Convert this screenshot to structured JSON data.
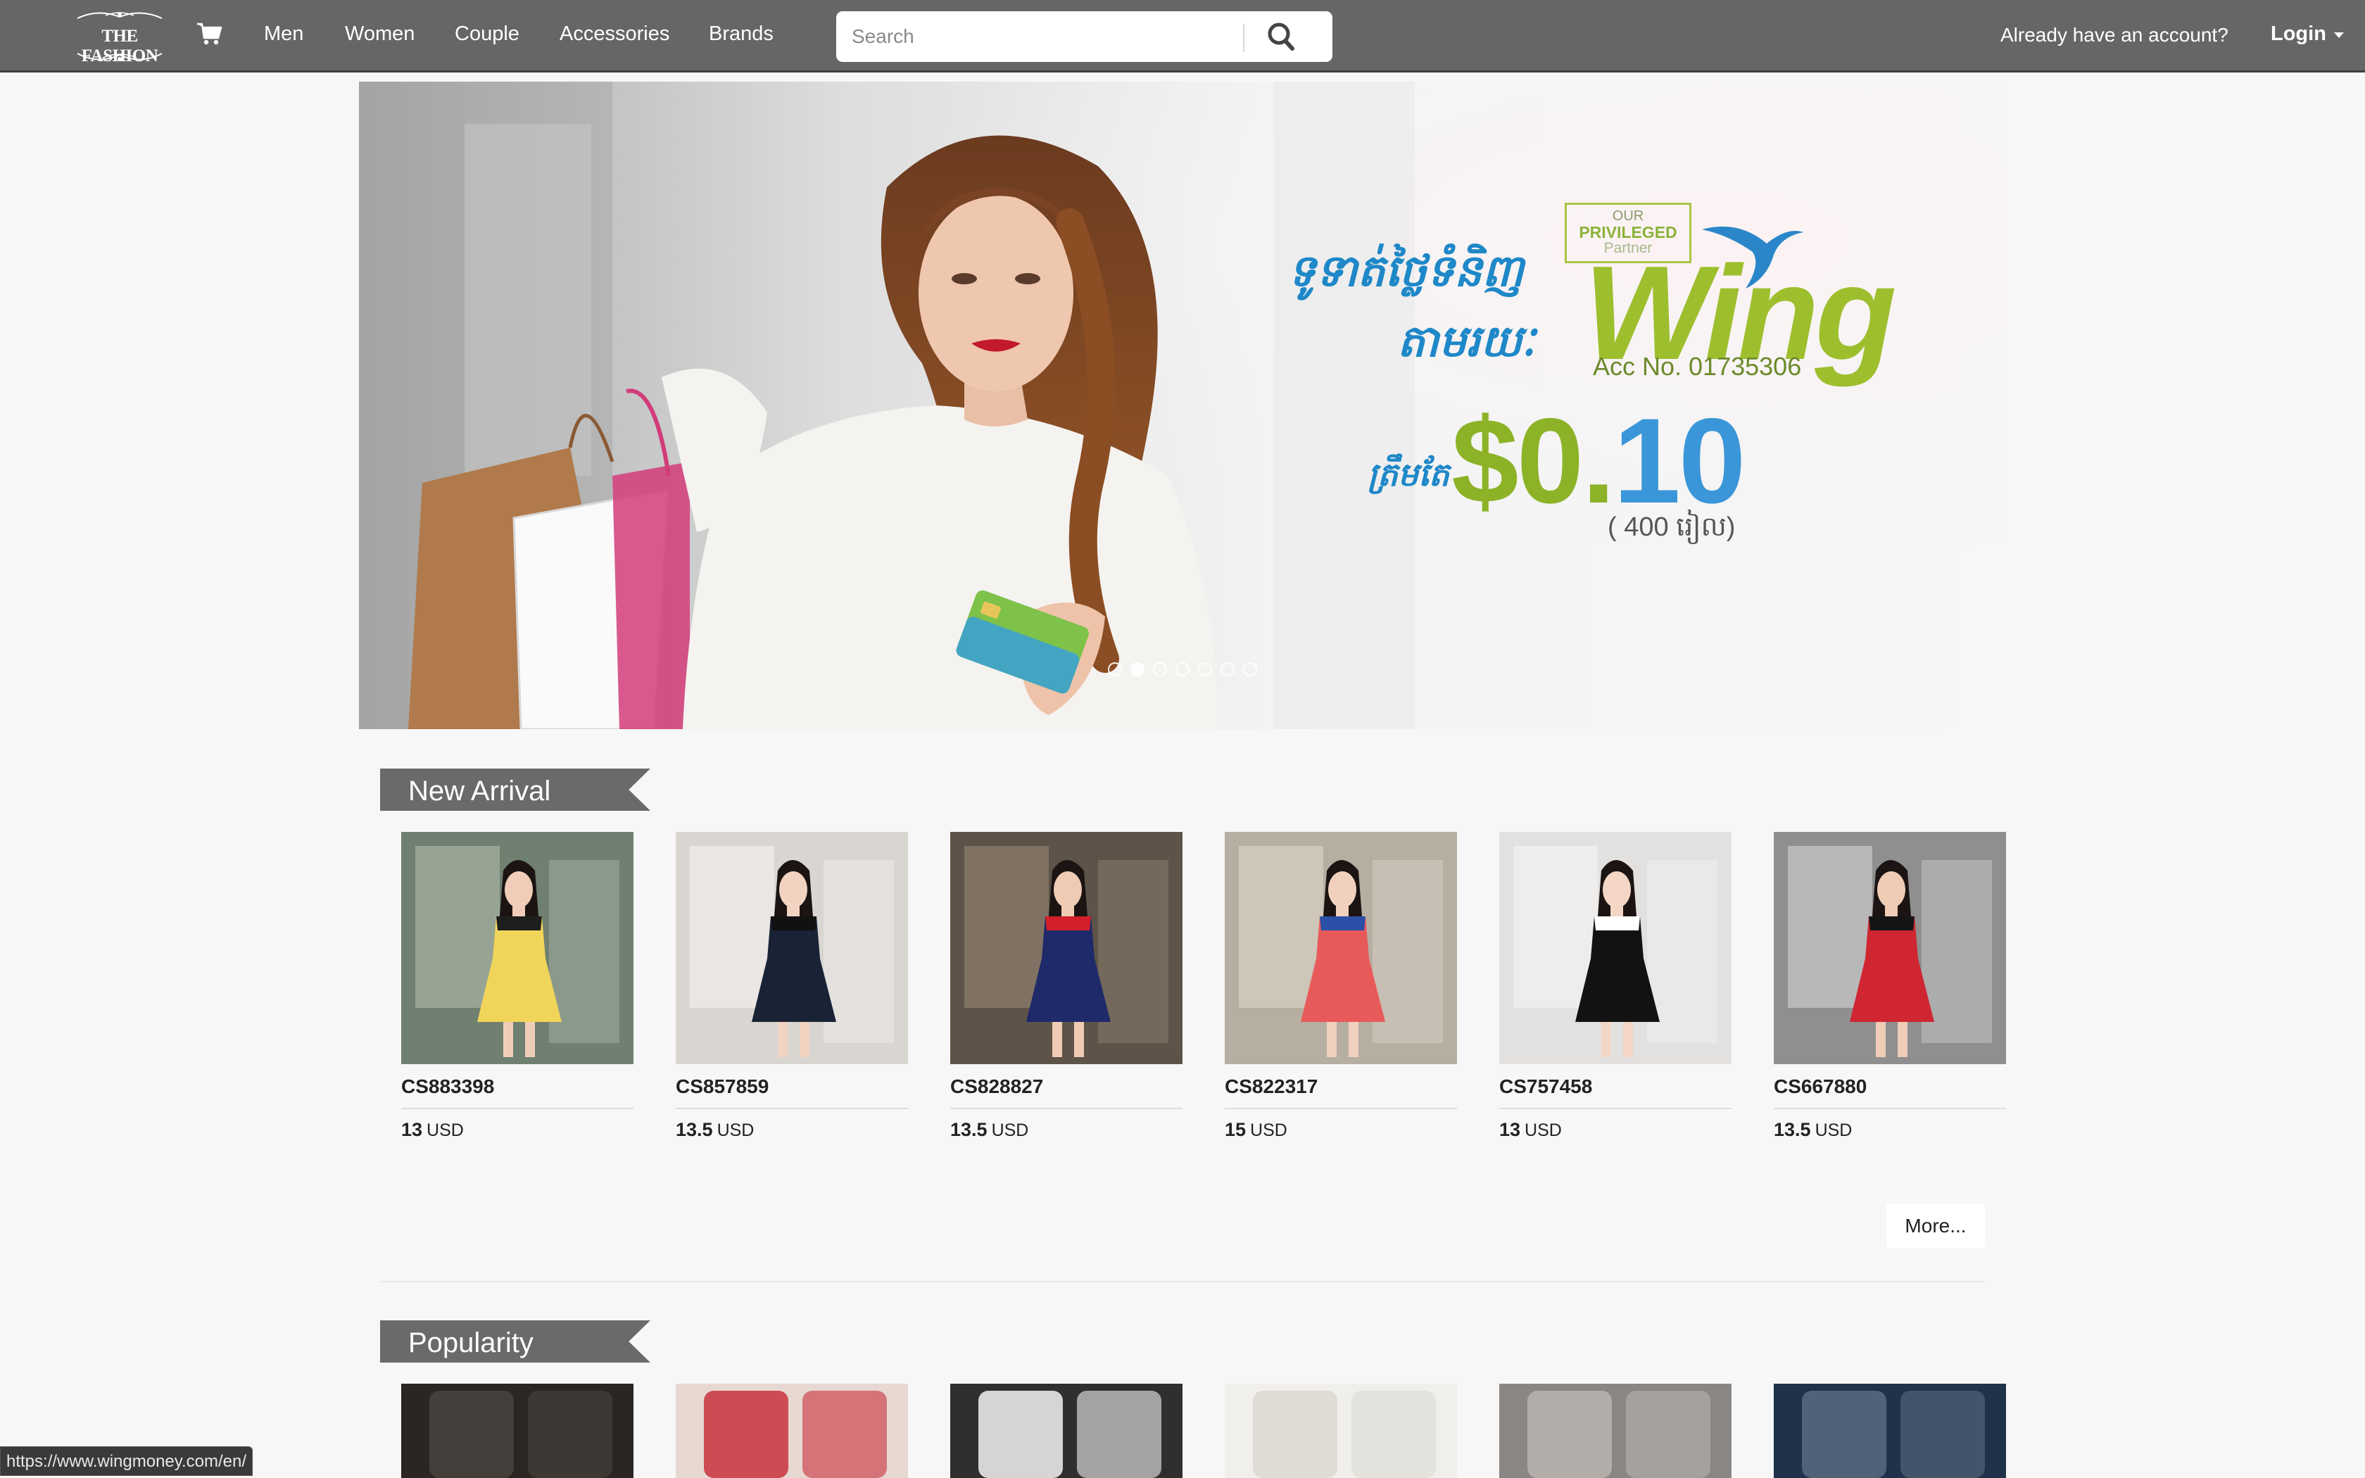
{
  "navbar": {
    "logo_text": "THE FASHION",
    "nav_items": [
      "Men",
      "Women",
      "Couple",
      "Accessories",
      "Brands"
    ],
    "search_placeholder": "Search",
    "account_prompt": "Already have an account?",
    "login_label": "Login",
    "colors": {
      "bar": "#666666",
      "text": "#ffffff"
    }
  },
  "banner": {
    "tagline_line1": "ទូទាត់ថ្លៃទំនិញ",
    "tagline_line2": "តាមរយៈ",
    "partner_our": "OUR",
    "partner_privileged": "PRIVILEGED",
    "partner_partner": "Partner",
    "brand_name": "Wing",
    "account_number": "Acc No. 01735306",
    "price_prefix": "ត្រឹមតែ",
    "price_dollars": "$0.",
    "price_cents": "10",
    "price_riel": "( 400 រៀល)",
    "slide_count": 7,
    "active_slide": 1
  },
  "new_arrival": {
    "title": "New Arrival",
    "products": [
      {
        "code": "CS883398",
        "price": "13",
        "currency": "USD"
      },
      {
        "code": "CS857859",
        "price": "13.5",
        "currency": "USD"
      },
      {
        "code": "CS828827",
        "price": "13.5",
        "currency": "USD"
      },
      {
        "code": "CS822317",
        "price": "15",
        "currency": "USD"
      },
      {
        "code": "CS757458",
        "price": "13",
        "currency": "USD"
      },
      {
        "code": "CS667880",
        "price": "13.5",
        "currency": "USD"
      }
    ],
    "more_label": "More..."
  },
  "popularity": {
    "title": "Popularity"
  },
  "status_bar": {
    "url": "https://www.wingmoney.com/en/"
  }
}
